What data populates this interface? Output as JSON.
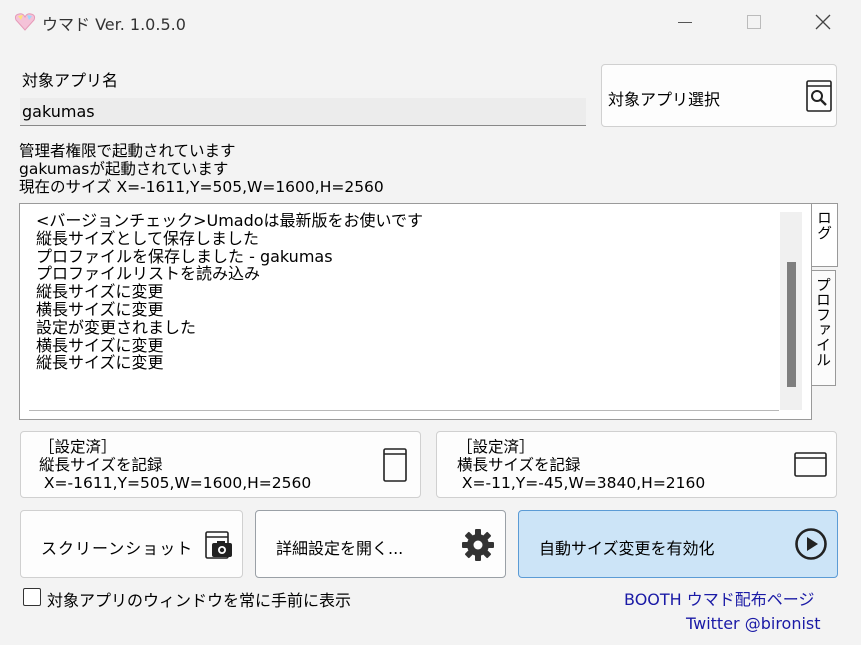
{
  "window": {
    "title": "ウマド Ver. 1.0.5.0",
    "icons": {
      "app": "heart-gem-icon",
      "minimize": "minimize-icon",
      "maximize": "maximize-icon",
      "close": "close-icon"
    }
  },
  "target": {
    "label": "対象アプリ名",
    "value": "gakumas",
    "select_button_label": "対象アプリ選択",
    "select_button_icon": "window-search-icon"
  },
  "status": {
    "lines": [
      "管理者権限で起動されています",
      "gakumasが起動されています",
      "現在のサイズ X=-1611,Y=505,W=1600,H=2560"
    ]
  },
  "log": {
    "lines": [
      "<バージョンチェック>Umadoは最新版をお使いです",
      "縦長サイズとして保存しました",
      "プロファイルを保存しました - gakumas",
      "プロファイルリストを読み込み",
      "縦長サイズに変更",
      "横長サイズに変更",
      "設定が変更されました",
      "横長サイズに変更",
      "縦長サイズに変更"
    ],
    "tabs": [
      "ログ",
      "プロファイル"
    ]
  },
  "records": {
    "portrait": {
      "status": "［設定済］",
      "label": "縦長サイズを記録",
      "value": " X=-1611,Y=505,W=1600,H=2560",
      "icon": "portrait-window-icon"
    },
    "landscape": {
      "status": "［設定済］",
      "label": "横長サイズを記録",
      "value": " X=-11,Y=-45,W=3840,H=2160",
      "icon": "landscape-window-icon"
    }
  },
  "actions": {
    "screenshot_label": "スクリーンショット",
    "screenshot_icon": "camera-icon",
    "settings_label": "詳細設定を開く...",
    "settings_icon": "gear-icon",
    "auto_label": "自動サイズ変更を有効化",
    "auto_icon": "play-circle-icon"
  },
  "footer": {
    "topmost_label": "対象アプリのウィンドウを常に手前に表示",
    "topmost_checked": false,
    "booth_link": "BOOTH ウマド配布ページ",
    "twitter_link": "Twitter @bironist"
  },
  "colors": {
    "accent_bg": "#cce4f7",
    "accent_border": "#5b9bd5",
    "link": "#1a1aa6"
  }
}
